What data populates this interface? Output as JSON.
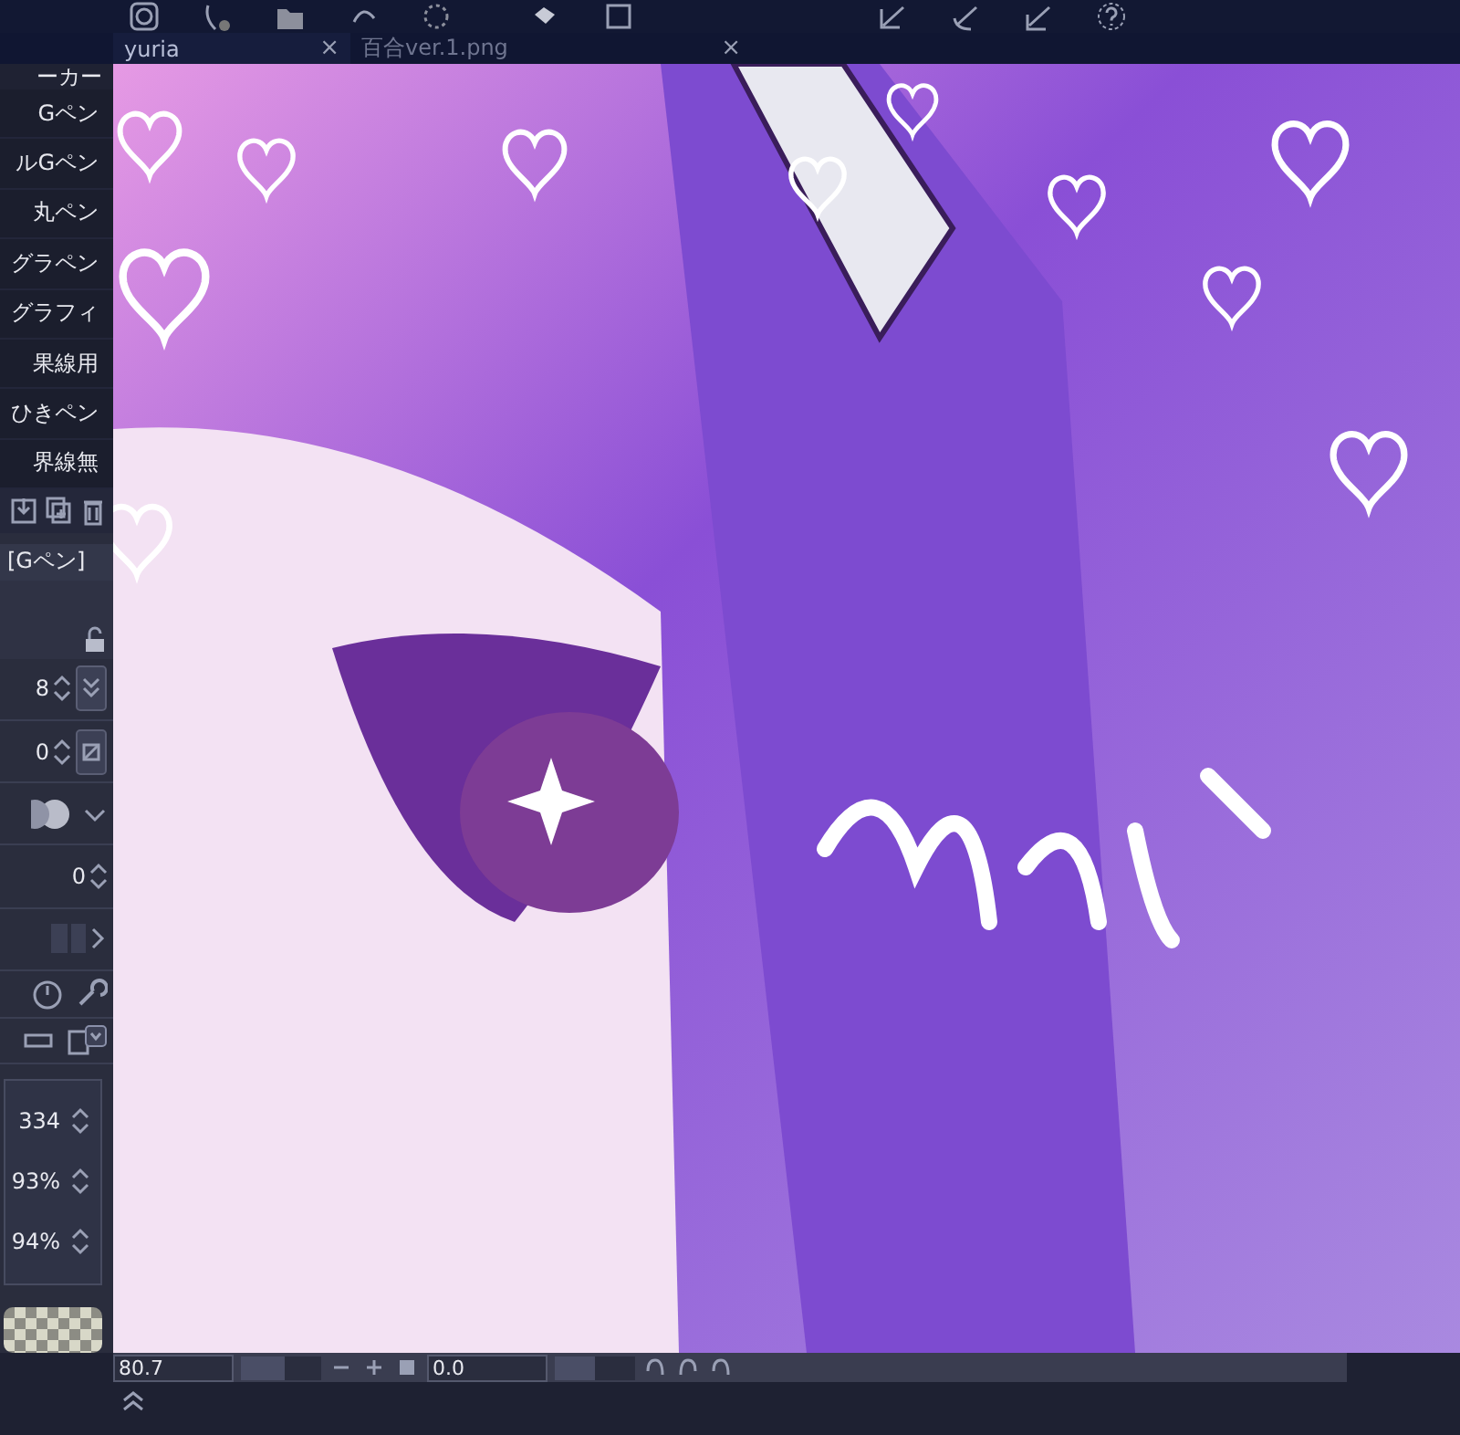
{
  "tabs": [
    {
      "label": "yuria",
      "selected": true,
      "close": "×"
    },
    {
      "label": "百合ver.1.png",
      "selected": false,
      "close": "×"
    }
  ],
  "brush_panel": {
    "header": "ーカー",
    "items": [
      "Gペン",
      "ルGペン",
      "丸ペン",
      "グラペン",
      "グラフィ",
      "果線用",
      "ひきペン",
      "界線無"
    ]
  },
  "tool_property": {
    "title": "[Gペン]",
    "values": [
      "8",
      "0",
      "0"
    ]
  },
  "layer_property": {
    "values": [
      "334",
      "93%",
      "94%"
    ]
  },
  "status_bar": {
    "zoom": "80.7",
    "zoom_slider": {
      "level": 0.55
    },
    "rotation": "0.0",
    "rotation_slider": {
      "level": 0.5
    }
  }
}
